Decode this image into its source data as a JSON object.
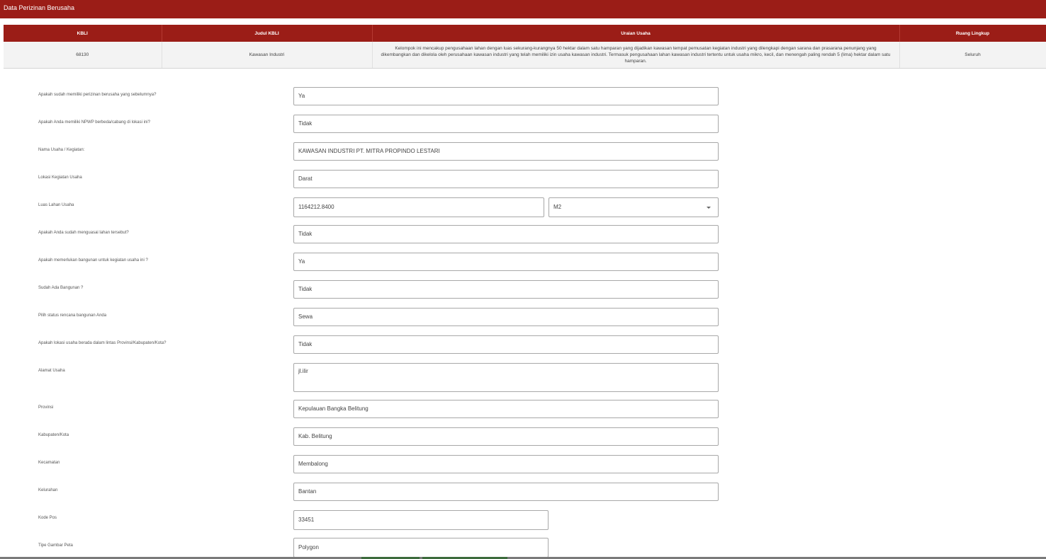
{
  "header": {
    "title": "Data Perizinan Berusaha"
  },
  "kbli_table": {
    "headers": [
      "KBLI",
      "Judul KBLI",
      "Uraian Usaha",
      "Ruang Lingkup"
    ],
    "row": {
      "kbli": "68130",
      "judul": "Kawasan Industri",
      "uraian": "Kelompok ini mencakup pengusahaan lahan dengan luas sekurang-kurangnya 50 hektar dalam satu hamparan yang dijadikan kawasan tempat pemusatan kegiatan industri yang dilengkapi dengan sarana dan prasarana penunjang yang dikembangkan dan dikelola oleh perusahaan kawasan industri yang telah memiliki izin usaha kawasan industri. Termasuk pengusahaan lahan kawasan industri tertentu untuk usaha mikro, kecil, dan menengah paling rendah 5 (lima) hektar dalam satu hamparan.",
      "ruang": "Seluruh"
    }
  },
  "form": {
    "perizinan_sebelumnya": {
      "label": "Apakah sudah memiliki perizinan berusaha yang sebelumnya?",
      "value": "Ya"
    },
    "npwp_cabang": {
      "label": "Apakah Anda memiliki NPWP berbeda/cabang di lokasi ini?",
      "value": "Tidak"
    },
    "nama_usaha": {
      "label": "Nama Usaha / Kegiatan:",
      "value": "KAWASAN INDUSTRI PT. MITRA PROPINDO LESTARI"
    },
    "lokasi_kegiatan": {
      "label": "Lokasi Kegiatan Usaha",
      "value": "Darat"
    },
    "luas_lahan": {
      "label": "Luas Lahan Usaha",
      "value": "1164212.8400",
      "unit": "M2"
    },
    "menguasai_lahan": {
      "label": "Apakah Anda sudah menguasai lahan tersebut?",
      "value": "Tidak"
    },
    "perlu_bangunan": {
      "label": "Apakah memerlukan bangunan untuk kegiatan usaha ini ?",
      "value": "Ya"
    },
    "ada_bangunan": {
      "label": "Sudah Ada Bangunan ?",
      "value": "Tidak"
    },
    "status_bangunan": {
      "label": "Pilih status rencana bangunan Anda",
      "value": "Sewa"
    },
    "lintas_wilayah": {
      "label": "Apakah lokasi usaha berada dalam lintas Provinsi/Kabupaten/Kota?",
      "value": "Tidak"
    },
    "alamat": {
      "label": "Alamat Usaha",
      "value": "jl.ilir"
    },
    "provinsi": {
      "label": "Provinsi",
      "value": "Kepulauan Bangka Belitung"
    },
    "kabupaten": {
      "label": "Kabupaten/Kota",
      "value": "Kab. Belitung"
    },
    "kecamatan": {
      "label": "Kecamatan",
      "value": "Membalong"
    },
    "kelurahan": {
      "label": "Kelurahan",
      "value": "Bantan"
    },
    "kode_pos": {
      "label": "Kode Pos",
      "value": "33451"
    },
    "tipe_peta": {
      "label": "Tipe Gambar Peta",
      "value": "Polygon"
    }
  },
  "colors": {
    "primary": "#9b1d17",
    "table_row_bg": "#f3f3f3",
    "border": "#a8a8a8"
  },
  "icons": {
    "select_caret": "caret-down-icon"
  }
}
